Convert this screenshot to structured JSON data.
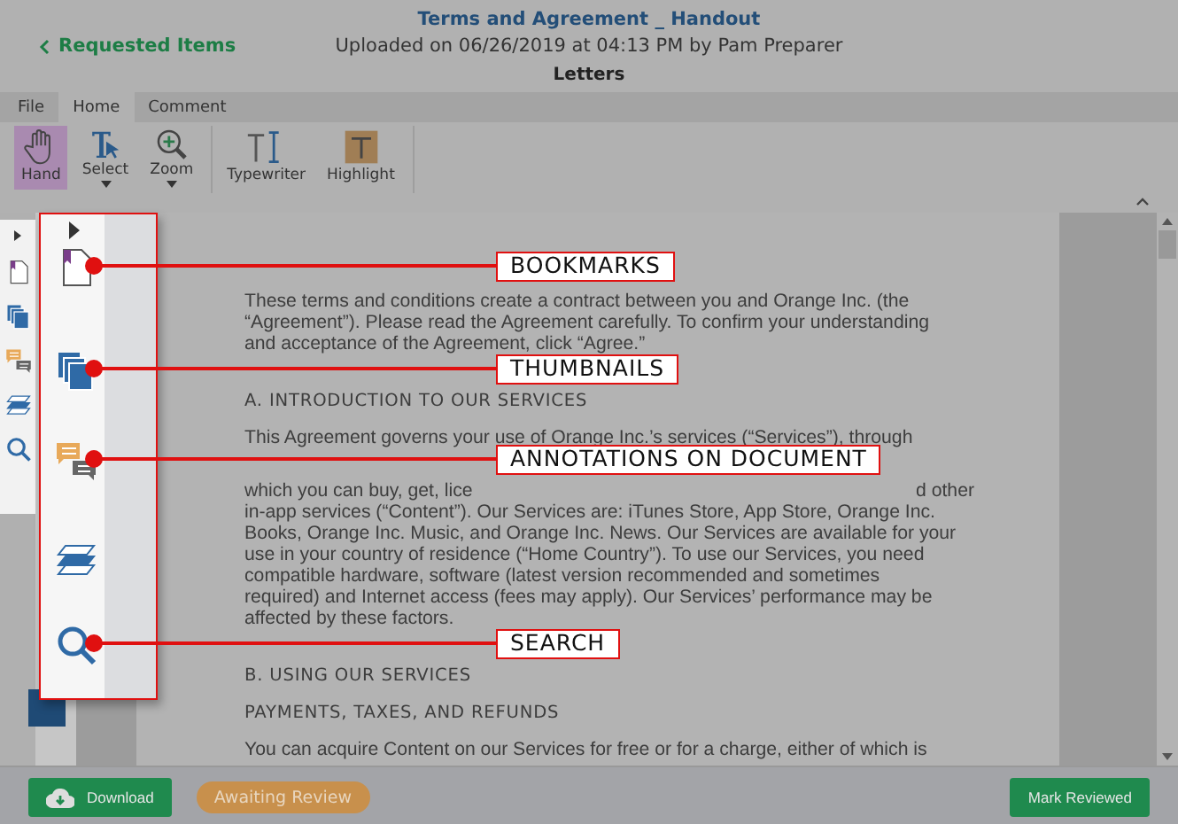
{
  "header": {
    "back_link": "Requested Items",
    "title": "Terms and Agreement _ Handout",
    "subtitle": "Uploaded on 06/26/2019 at 04:13 PM by Pam Preparer",
    "section": "Letters"
  },
  "tabs": [
    {
      "label": "File",
      "selected": false
    },
    {
      "label": "Home",
      "selected": true
    },
    {
      "label": "Comment",
      "selected": false
    }
  ],
  "tool_groups": [
    [
      {
        "kind": "hand",
        "label": "Hand",
        "selected": true,
        "dropdown": false
      },
      {
        "kind": "select",
        "label": "Select",
        "selected": false,
        "dropdown": true
      },
      {
        "kind": "zoom",
        "label": "Zoom",
        "selected": false,
        "dropdown": true
      }
    ],
    [
      {
        "kind": "typewriter",
        "label": "Typewriter",
        "selected": false,
        "dropdown": false
      },
      {
        "kind": "highlight",
        "label": "Highlight",
        "selected": false,
        "dropdown": false
      }
    ]
  ],
  "sidebar": {
    "panels": [
      {
        "kind": "bookmarks",
        "callout": "BOOKMARKS"
      },
      {
        "kind": "thumbnails",
        "callout": "THUMBNAILS"
      },
      {
        "kind": "annotations",
        "callout": "ANNOTATIONS ON DOCUMENT"
      },
      {
        "kind": "layers"
      },
      {
        "kind": "search",
        "callout": "SEARCH"
      }
    ]
  },
  "document": {
    "blocks": [
      {
        "kind": "paragraph",
        "lines": [
          {
            "text": "These terms and conditions create a contract between you and Orange Inc. (the"
          },
          {
            "text": "“Agreement”). Please read the Agreement carefully. To confirm your understanding"
          },
          {
            "text": "and acceptance of the Agreement, click “Agree.”"
          }
        ]
      },
      {
        "kind": "heading",
        "text": "A. INTRODUCTION TO OUR SERVICES"
      },
      {
        "kind": "paragraph",
        "lines": [
          {
            "text": "This Agreement governs your use of Orange Inc.’s services (“Services”), through"
          },
          {
            "parts": [
              "which you can buy, get, lice",
              "d other"
            ]
          },
          {
            "text": "in-app services (“Content”). Our Services are: iTunes Store, App Store, Orange Inc."
          },
          {
            "text": "Books, Orange Inc. Music, and Orange Inc. News. Our Services are available for your"
          },
          {
            "text": "use in your country of residence (“Home Country”). To use our Services, you need"
          },
          {
            "text": "compatible hardware, software (latest version recommended and sometimes"
          },
          {
            "text": "required) and Internet access (fees may apply). Our Services’ performance may be"
          },
          {
            "text": "affected by these factors."
          }
        ]
      },
      {
        "kind": "heading",
        "text": "B. USING OUR SERVICES"
      },
      {
        "kind": "heading",
        "text": "PAYMENTS, TAXES, AND REFUNDS"
      },
      {
        "kind": "paragraph",
        "lines": [
          {
            "text": "You can acquire Content on our Services for free or for a charge, either of which is"
          }
        ]
      }
    ]
  },
  "footer": {
    "download": "Download",
    "status": "Awaiting Review",
    "mark": "Mark Reviewed"
  }
}
